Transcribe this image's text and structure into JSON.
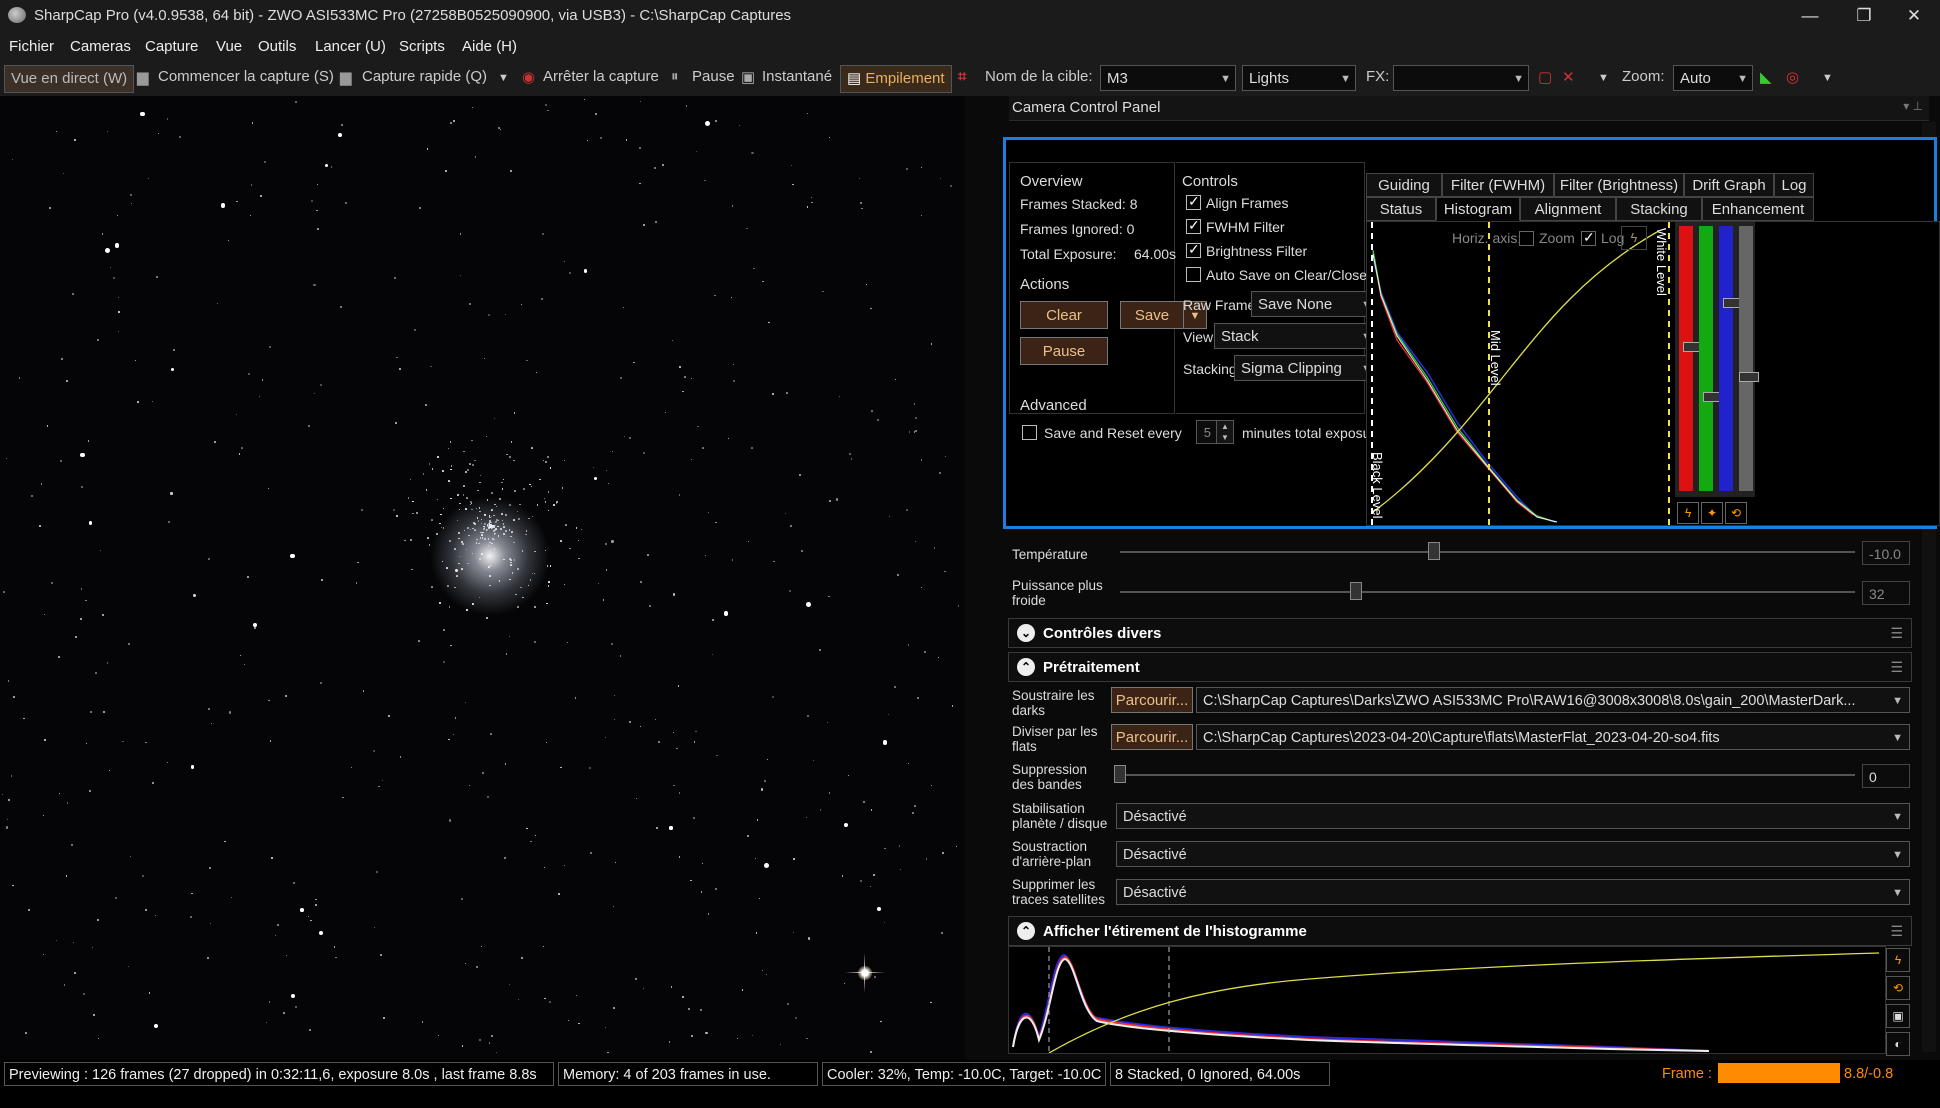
{
  "window": {
    "title": "SharpCap Pro (v4.0.9538, 64 bit) - ZWO ASI533MC Pro (27258B0525090900, via USB3) - C:\\SharpCap Captures",
    "minimize": "—",
    "restore": "❐",
    "close": "✕"
  },
  "menu": [
    "Fichier",
    "Cameras",
    "Capture",
    "Vue",
    "Outils",
    "Lancer (U)",
    "Scripts",
    "Aide (H)"
  ],
  "toolbar": {
    "live": "Vue en direct (W)",
    "start_capture": "Commencer la capture (S)",
    "quick_capture": "Capture rapide (Q)",
    "stop_capture": "Arrêter la capture",
    "pause": "Pause",
    "snapshot": "Instantané",
    "stacking": "Empilement",
    "target_label": "Nom de la cible:",
    "target_value": "M3",
    "frame_type": "Lights",
    "fx_label": "FX:",
    "fx_value": "",
    "zoom_label": "Zoom:",
    "zoom_value": "Auto"
  },
  "camera_panel": {
    "title": "Camera Control Panel"
  },
  "stack": {
    "overview": {
      "heading": "Overview",
      "frames_stacked": "Frames Stacked: 8",
      "frames_ignored": "Frames Ignored: 0",
      "total_exposure_label": "Total Exposure:",
      "total_exposure_value": "64.00s"
    },
    "actions": {
      "heading": "Actions",
      "clear": "Clear",
      "save": "Save",
      "pause": "Pause"
    },
    "advanced": {
      "heading": "Advanced",
      "save_reset_label": "Save and Reset every",
      "save_reset_value": "5",
      "save_reset_suffix": "minutes total exposure"
    },
    "controls": {
      "heading": "Controls",
      "align_frames": "Align Frames",
      "fwhm_filter": "FWHM Filter",
      "brightness_filter": "Brightness Filter",
      "auto_save": "Auto Save on Clear/Close",
      "raw_frames_label": "Raw Frames",
      "raw_frames_value": "Save None",
      "view_label": "View",
      "view_value": "Stack",
      "stacking_label": "Stacking",
      "stacking_value": "Sigma Clipping"
    },
    "checkboxes": {
      "align_frames": true,
      "fwhm_filter": true,
      "brightness_filter": true,
      "auto_save": false,
      "save_reset": false
    },
    "tabs_row1": [
      "Guiding",
      "Filter (FWHM)",
      "Filter (Brightness)",
      "Drift Graph",
      "Log"
    ],
    "tabs_row2": [
      "Status",
      "Histogram",
      "Alignment",
      "Stacking",
      "Enhancement"
    ],
    "active_tab": "Histogram",
    "histogram": {
      "horiz_axis_label": "Horiz. axis:",
      "zoom_label": "Zoom",
      "log_label": "Log",
      "zoom_checked": false,
      "log_checked": true,
      "black_level": "Black Level",
      "mid_level": "Mid Level",
      "white_level": "White Level"
    }
  },
  "camera_controls": {
    "temperature_label": "Température",
    "temperature_value": "-10.0",
    "cooler_power_label": "Puissance plus froide",
    "cooler_power_value": "32"
  },
  "groups": {
    "misc": "Contrôles divers",
    "preprocessing": "Prétraitement",
    "stretch": "Afficher l'étirement de l'histogramme"
  },
  "preprocessing": {
    "browse_label": "Parcourir...",
    "darks_label": "Soustraire les darks",
    "darks_path": "C:\\SharpCap Captures\\Darks\\ZWO ASI533MC Pro\\RAW16@3008x3008\\8.0s\\gain_200\\MasterDark...",
    "flats_label": "Diviser par les flats",
    "flats_path": "C:\\SharpCap Captures\\2023-04-20\\Capture\\flats\\MasterFlat_2023-04-20-so4.fits",
    "banding_label": "Suppression des bandes",
    "banding_value": "0",
    "stabilization_label": "Stabilisation planète / disque",
    "stabilization_value": "Désactivé",
    "background_label": "Soustraction d'arrière-plan",
    "background_value": "Désactivé",
    "satellite_label": "Supprimer les traces satellites",
    "satellite_value": "Désactivé"
  },
  "status": {
    "preview": "Previewing : 126 frames (27 dropped) in 0:32:11,6, exposure 8.0s , last frame 8.8s",
    "memory": "Memory: 4 of 203 frames in use.",
    "cooler": "Cooler: 32%, Temp: -10.0C, Target: -10.0C",
    "stack": "8 Stacked, 0 Ignored, 64.00s",
    "frame_label": "Frame :",
    "frame_value": "8.8/-0.8",
    "frame_progress": 1.0
  },
  "colors": {
    "accent": "#e8b060",
    "selection_border": "#1b7fe0",
    "frame_bar": "#ff8c00"
  }
}
